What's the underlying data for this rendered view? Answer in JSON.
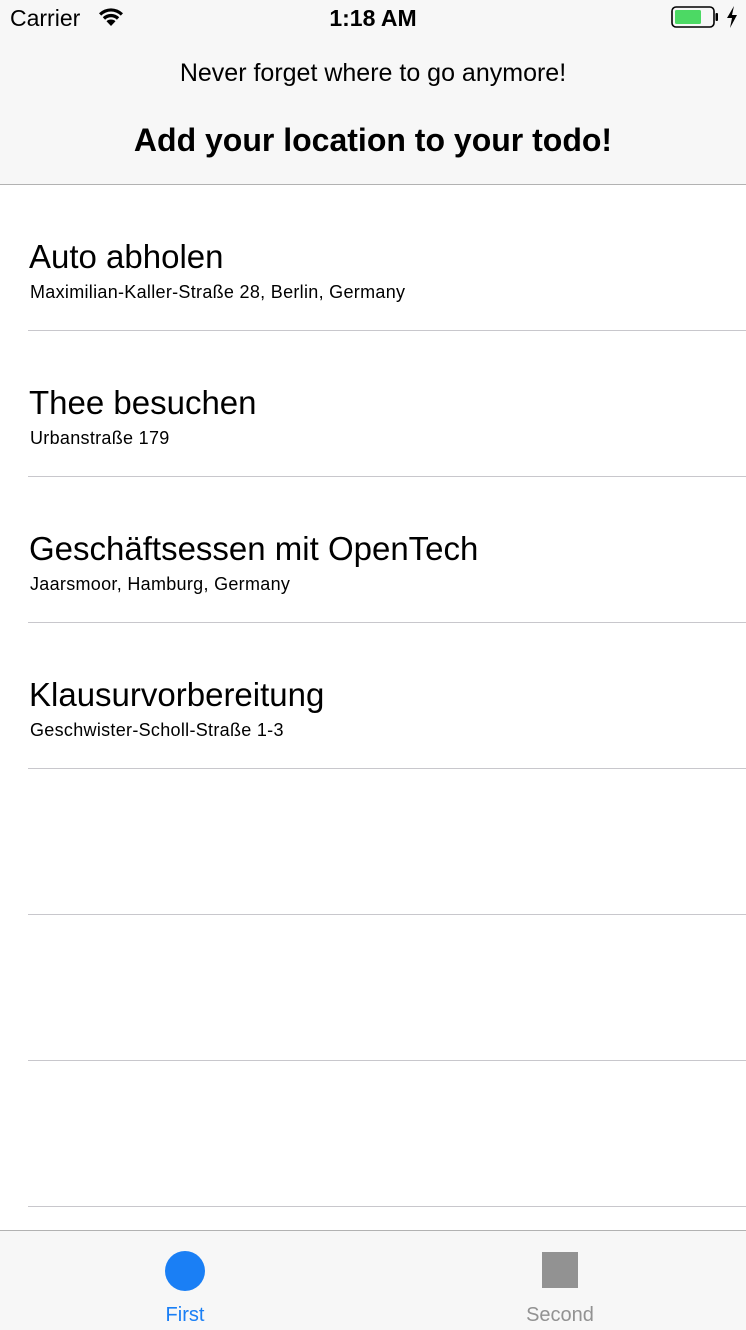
{
  "status_bar": {
    "carrier": "Carrier",
    "time": "1:18 AM",
    "wifi_icon": "wifi-icon",
    "battery_icon": "battery-icon",
    "charging_icon": "charging-bolt-icon",
    "battery_color": "#4cd964"
  },
  "header": {
    "subtitle": "Never forget where to go anymore!",
    "title": "Add your location to your todo!"
  },
  "todos": [
    {
      "title": "Auto abholen",
      "location": "Maximilian-Kaller-Straße 28, Berlin, Germany"
    },
    {
      "title": "Thee besuchen",
      "location": "Urbanstraße 179"
    },
    {
      "title": "Geschäftsessen mit OpenTech",
      "location": "Jaarsmoor, Hamburg, Germany"
    },
    {
      "title": "Klausurvorbereitung",
      "location": "Geschwister-Scholl-Straße 1-3"
    }
  ],
  "tabbar": {
    "tabs": [
      {
        "label": "First",
        "icon": "circle-icon",
        "selected": true
      },
      {
        "label": "Second",
        "icon": "square-icon",
        "selected": false
      }
    ],
    "active_color": "#1a7ff5",
    "inactive_color": "#929292"
  }
}
